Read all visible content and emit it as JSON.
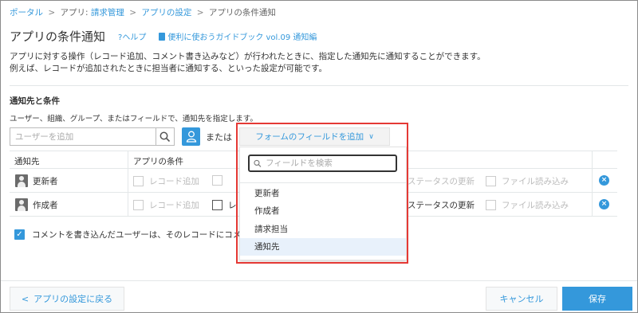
{
  "breadcrumb": {
    "portal": "ポータル",
    "app_prefix": "アプリ:",
    "app_name": "請求管理",
    "settings": "アプリの設定",
    "current": "アプリの条件通知",
    "sep": ">"
  },
  "header": {
    "title": "アプリの条件通知",
    "help": "?ヘルプ",
    "guide": "便利に使おうガイドブック vol.09 通知編"
  },
  "description": {
    "line1": "アプリに対する操作（レコード追加、コメント書き込みなど）が行われたときに、指定した通知先に通知することができます。",
    "line2": "例えば、レコードが追加されたときに担当者に通知する、といった設定が可能です。"
  },
  "section": {
    "title": "通知先と条件",
    "desc": "ユーザー、組織、グループ、またはフィールドで、通知先を指定します。",
    "user_placeholder": "ユーザーを追加",
    "or": "または",
    "add_field": "フォームのフィールドを追加"
  },
  "table": {
    "headers": {
      "recipient": "通知先",
      "conditions": "アプリの条件"
    },
    "rows": [
      {
        "name": "更新者",
        "record_add": "レコード追加",
        "status_update": "ステータスの更新",
        "file_read": "ファイル読み込み"
      },
      {
        "name": "作成者",
        "record_add": "レコード追加",
        "col2_partial": "レ",
        "status_update": "ステータスの更新",
        "file_read": "ファイル読み込み"
      }
    ]
  },
  "comment_option": "コメントを書き込んだユーザーは、そのレコードにコメ",
  "dropdown": {
    "search_placeholder": "フィールドを検索",
    "items": [
      "更新者",
      "作成者",
      "請求担当",
      "通知先"
    ]
  },
  "footer": {
    "back": "アプリの設定に戻る",
    "cancel": "キャンセル",
    "save": "保存"
  },
  "colors": {
    "accent": "#3498db",
    "highlight": "#e53935"
  }
}
